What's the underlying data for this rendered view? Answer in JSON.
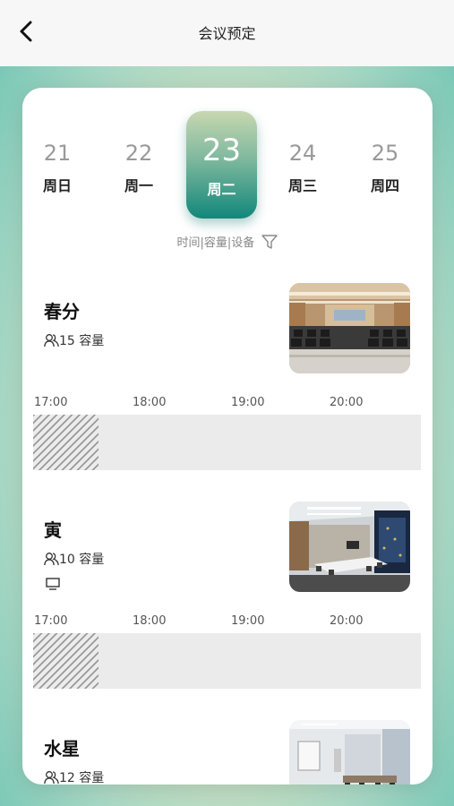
{
  "header": {
    "title": "会议预定",
    "back_icon": "chevron-left-icon"
  },
  "dates": [
    {
      "day": "21",
      "weekday": "周日",
      "selected": false
    },
    {
      "day": "22",
      "weekday": "周一",
      "selected": false
    },
    {
      "day": "23",
      "weekday": "周二",
      "selected": true
    },
    {
      "day": "24",
      "weekday": "周三",
      "selected": false
    },
    {
      "day": "25",
      "weekday": "周四",
      "selected": false
    }
  ],
  "filter": {
    "label": "时间|容量|设备",
    "icon": "filter-icon"
  },
  "time_labels": [
    "17:00",
    "18:00",
    "19:00",
    "20:00"
  ],
  "rooms": [
    {
      "name": "春分",
      "capacity": "15 容量",
      "has_tv": false,
      "photo": "auditorium"
    },
    {
      "name": "寅",
      "capacity": "10 容量",
      "has_tv": true,
      "photo": "conference-room"
    },
    {
      "name": "水星",
      "capacity": "12 容量",
      "has_tv": false,
      "photo": "meeting-room"
    }
  ],
  "colors": {
    "accent": "#11877a",
    "accent_light": "#c8d7b0",
    "booked_bg": "#ebebeb"
  }
}
